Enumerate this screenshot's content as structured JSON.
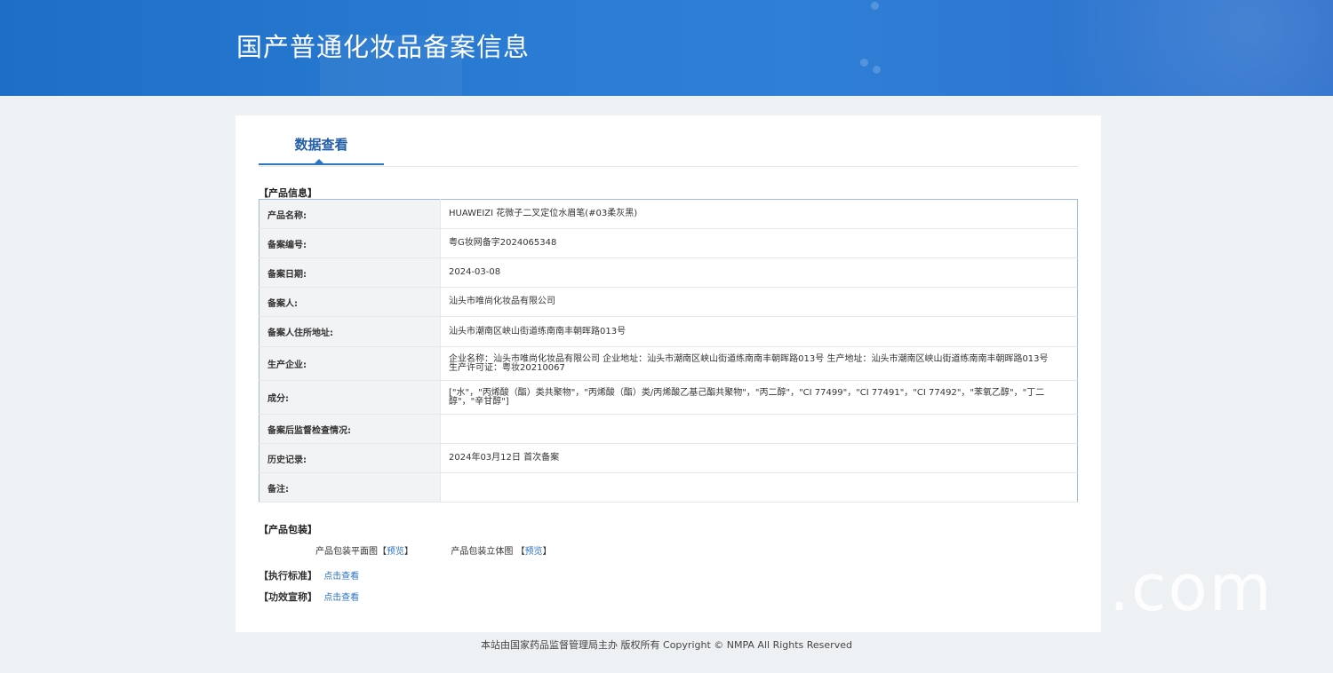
{
  "header": {
    "title": "国产普通化妆品备案信息"
  },
  "tabs": [
    {
      "label": "数据查看"
    }
  ],
  "sections": {
    "product_info": "【产品信息】",
    "packaging": "【产品包装】",
    "standard": "【执行标准】",
    "efficacy": "【功效宣称】"
  },
  "product_info": [
    {
      "key": "产品名称:",
      "value": "HUAWEIZI 花微子二叉定位水眉笔(#03柔灰黑)"
    },
    {
      "key": "备案编号:",
      "value": "粤G妆网备字2024065348"
    },
    {
      "key": "备案日期:",
      "value": "2024-03-08"
    },
    {
      "key": "备案人:",
      "value": "汕头市唯尚化妆品有限公司"
    },
    {
      "key": "备案人住所地址:",
      "value": "汕头市潮南区峡山街道练南南丰朝晖路013号"
    },
    {
      "key": "生产企业:",
      "value": "企业名称：汕头市唯尚化妆品有限公司 企业地址：汕头市潮南区峡山街道练南南丰朝晖路013号 生产地址：汕头市潮南区峡山街道练南南丰朝晖路013号 生产许可证：粤妆20210067"
    },
    {
      "key": "成分:",
      "value": "[\"水\"，\"丙烯酸（酯）类共聚物\"，\"丙烯酸（酯）类/丙烯酸乙基己酯共聚物\"，\"丙二醇\"，\"CI 77499\"，\"CI 77491\"，\"CI 77492\"，\"苯氧乙醇\"，\"丁二醇\"，\"辛甘醇\"]"
    },
    {
      "key": "备案后监督检查情况:",
      "value": ""
    },
    {
      "key": "历史记录:",
      "value": "2024年03月12日 首次备案"
    },
    {
      "key": "备注:",
      "value": ""
    }
  ],
  "packaging": {
    "flat_label": "产品包装平面图",
    "flat_link": "预览",
    "solid_label": "产品包装立体图",
    "solid_link": "预览",
    "bracket_open": "【",
    "bracket_close": "】"
  },
  "standard_link": "点击查看",
  "efficacy_link": "点击查看",
  "footer": "本站由国家药品监督管理局主办 版权所有 Copyright © NMPA All Rights Reserved",
  "watermark": ".com",
  "colors": {
    "banner": "#2a7bd3",
    "accent": "#2d74c4",
    "key_bg": "#f2f3f5",
    "page_bg": "#eef1f4"
  }
}
